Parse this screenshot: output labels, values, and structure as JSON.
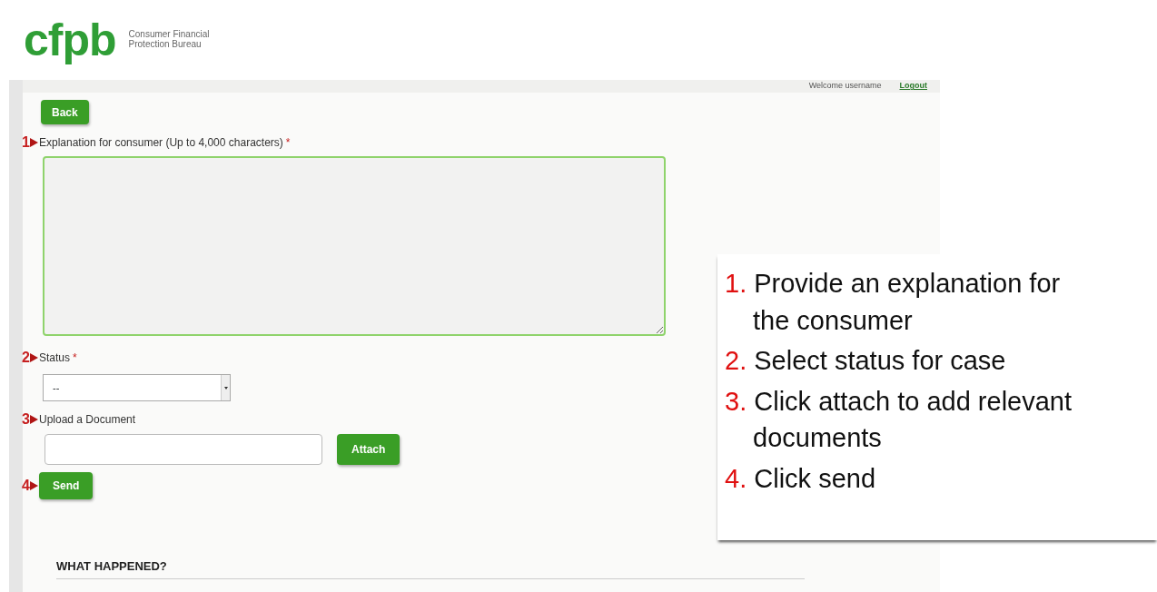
{
  "logo": {
    "mark": "cfpb",
    "name_lines": [
      "Consumer Financial",
      "Protection Bureau"
    ]
  },
  "header": {
    "welcome": "Welcome",
    "username": "username",
    "logout": "Logout"
  },
  "back_button": "Back",
  "fields": [
    {
      "kind": "textarea",
      "step": "1",
      "label": "Explanation for consumer (Up to 4,000 characters)",
      "required_mark": "*"
    },
    {
      "kind": "select",
      "step": "2",
      "label": "Status",
      "required_mark": "*",
      "value": "--"
    },
    {
      "kind": "file",
      "step": "3",
      "label": "Upload a Document",
      "button": "Attach"
    }
  ],
  "send": {
    "step": "4",
    "label": "Send"
  },
  "section_heading": "WHAT HAPPENED?",
  "callout": {
    "steps": [
      {
        "number": "1.",
        "text": "Provide an explanation for the consumer"
      },
      {
        "number": "2.",
        "text": "Select status for case"
      },
      {
        "number": "3.",
        "text": "Click attach to add relevant documents"
      },
      {
        "number": "4.",
        "text": "Click send"
      }
    ]
  }
}
